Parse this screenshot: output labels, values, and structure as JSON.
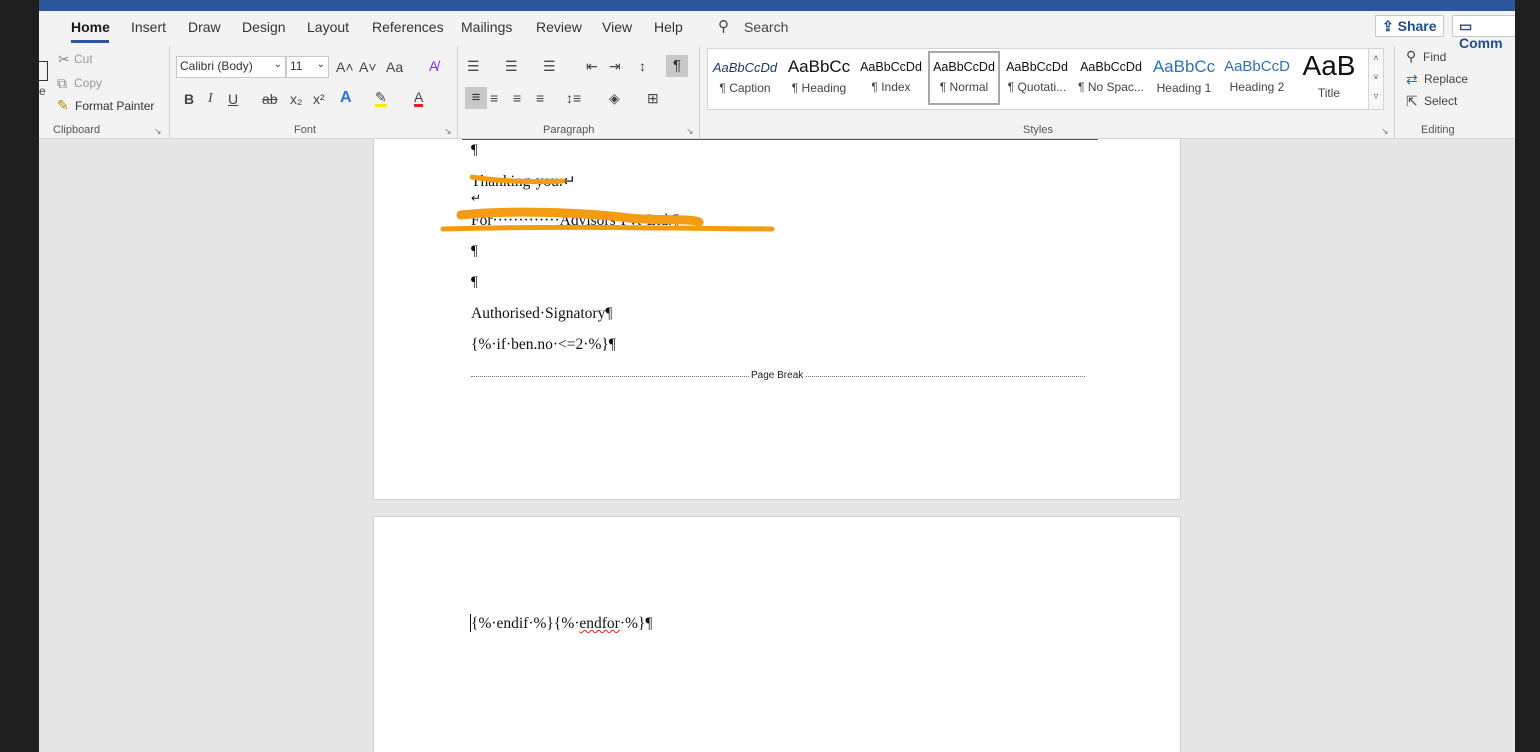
{
  "tabs": [
    "Home",
    "Insert",
    "Draw",
    "Design",
    "Layout",
    "References",
    "Mailings",
    "Review",
    "View",
    "Help"
  ],
  "search": {
    "label": "Search"
  },
  "actions": {
    "share": "Share",
    "comments": "Comm"
  },
  "clipboard": {
    "cut": "Cut",
    "copy": "Copy",
    "format_painter": "Format Painter",
    "group_label": "Clipboard"
  },
  "font": {
    "family": "Calibri (Body)",
    "size": "11",
    "change_case": "Aa",
    "group_label": "Font",
    "bold": "B",
    "italic": "I",
    "underline": "U",
    "strike": "ab",
    "subscript": "x₂",
    "superscript": "x²"
  },
  "paragraph": {
    "group_label": "Paragraph"
  },
  "styles": {
    "group_label": "Styles",
    "items": [
      {
        "preview": "AaBbCcDd",
        "name": "¶ Caption"
      },
      {
        "preview": "AaBbCc",
        "name": "¶ Heading"
      },
      {
        "preview": "AaBbCcDd",
        "name": "¶ Index"
      },
      {
        "preview": "AaBbCcDd",
        "name": "¶ Normal"
      },
      {
        "preview": "AaBbCcDd",
        "name": "¶ Quotati..."
      },
      {
        "preview": "AaBbCcDd",
        "name": "¶ No Spac..."
      },
      {
        "preview": "AaBbCc",
        "name": "Heading 1"
      },
      {
        "preview": "AaBbCcD",
        "name": "Heading 2"
      },
      {
        "preview": "AaB",
        "name": "Title"
      }
    ]
  },
  "editing": {
    "find": "Find",
    "replace": "Replace",
    "select": "Select",
    "group_label": "Editing"
  },
  "document": {
    "page1": {
      "pilcrow": "¶",
      "thanking": "Thanking·you.↵",
      "line_break": "↵",
      "company": "For·············Advisors·Pvt·Ltd.¶",
      "signatory": "Authorised·Signatory¶",
      "if_tag": "{%·if·ben.no·<=2·%}¶",
      "page_break": "Page Break"
    },
    "page2": {
      "endtags_prefix": "{%·endif·%}{%·",
      "endtags_word": "endfor",
      "endtags_suffix": "·%}¶"
    }
  },
  "colors": {
    "accent": "#2b579a",
    "redaction": "#f39c12",
    "spellcheck": "#e02020"
  }
}
